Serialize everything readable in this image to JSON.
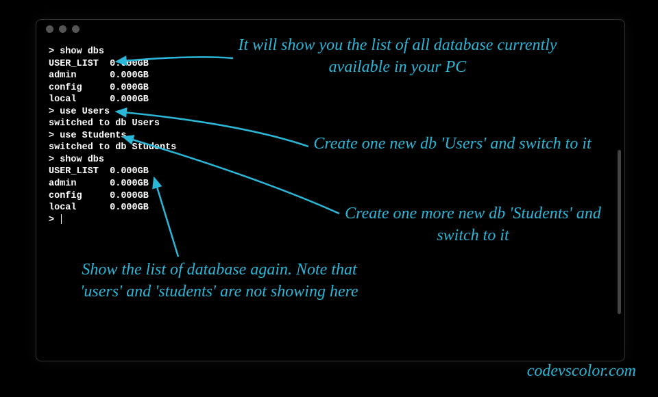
{
  "terminal": {
    "lines": [
      "> show dbs",
      "USER_LIST  0.000GB",
      "admin      0.000GB",
      "config     0.000GB",
      "local      0.000GB",
      "> use Users",
      "switched to db Users",
      "> use Students",
      "switched to db Students",
      "> show dbs",
      "USER_LIST  0.000GB",
      "admin      0.000GB",
      "config     0.000GB",
      "local      0.000GB",
      "> "
    ]
  },
  "annotations": {
    "a1": "It will show you the list of all database currently available in your PC",
    "a2": "Create one new db 'Users' and switch to it",
    "a3": "Create one more new db 'Students' and switch to it",
    "a4": "Show the list of database again. Note that 'users' and 'students' are not showing here"
  },
  "watermark": "codevscolor.com",
  "colors": {
    "annotation": "#2ab7d8",
    "terminal_text": "#ffffff",
    "background": "#000000"
  }
}
